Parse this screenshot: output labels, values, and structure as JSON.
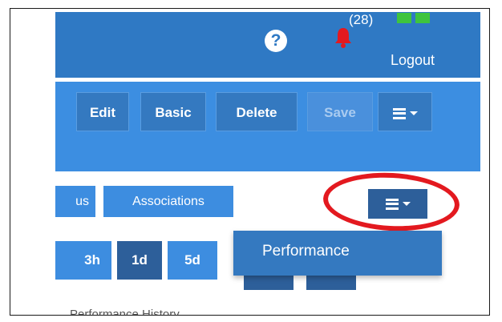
{
  "header": {
    "help_icon_glyph": "?",
    "notification_count": "(28)",
    "logout_label": "Logout",
    "status_color": "#3ec43e"
  },
  "toolbar": {
    "edit_label": "Edit",
    "basic_label": "Basic",
    "delete_label": "Delete",
    "save_label": "Save"
  },
  "tabs": {
    "partial_tab_label": "us",
    "associations_label": "Associations"
  },
  "menu": {
    "items": [
      {
        "label": "Performance"
      }
    ]
  },
  "time_range": {
    "buttons": [
      {
        "label": "3h",
        "active": false
      },
      {
        "label": "1d",
        "active": true
      },
      {
        "label": "5d",
        "active": false
      }
    ]
  },
  "sub_tabs_cut_text": "Performance    History",
  "colors": {
    "header_blue": "#2f79c4",
    "toolbar_blue": "#3c8ee1",
    "button_blue": "#3479c0",
    "dark_blue": "#2d5f9a",
    "highlight_red": "#e3191f"
  }
}
